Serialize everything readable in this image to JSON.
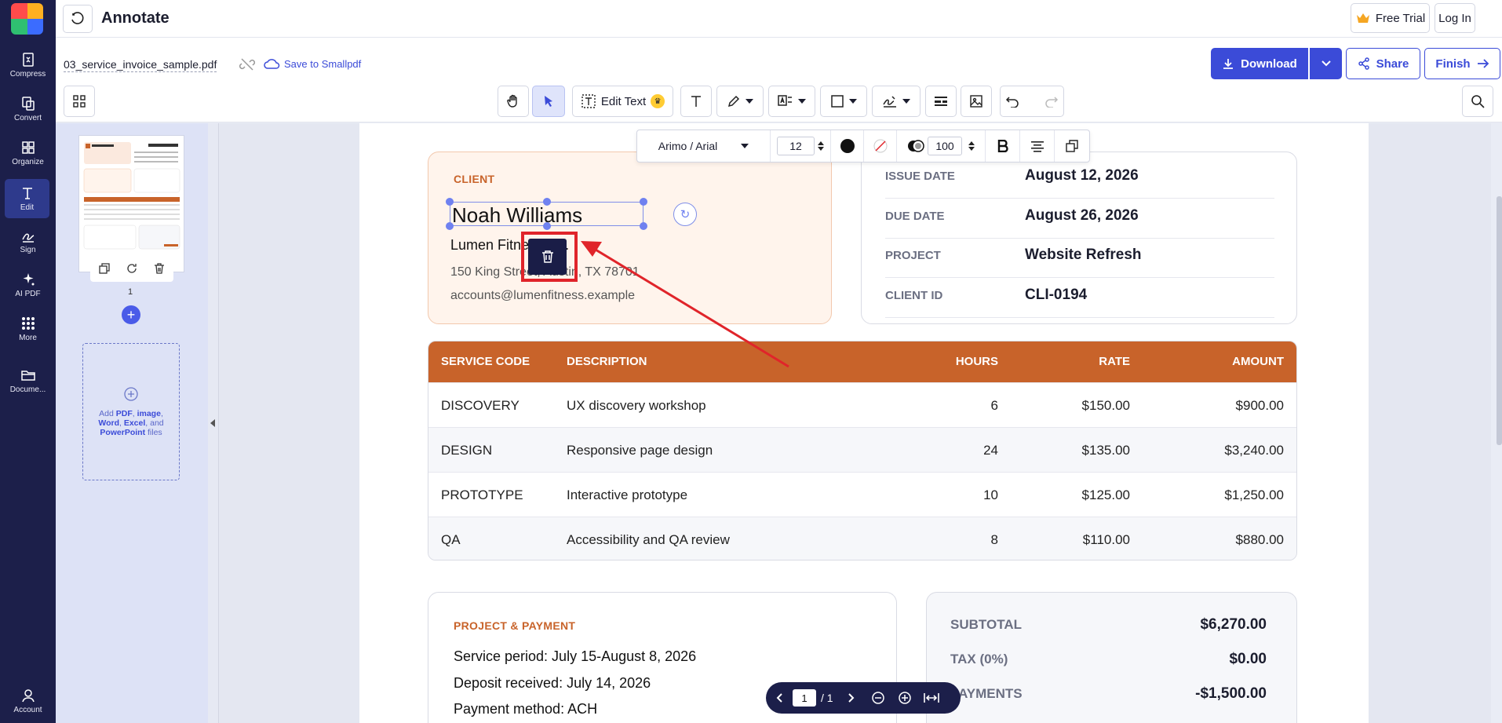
{
  "app": {
    "title": "Annotate"
  },
  "rail": {
    "items": [
      {
        "label": "Compress",
        "icon": "compress-icon"
      },
      {
        "label": "Convert",
        "icon": "convert-icon"
      },
      {
        "label": "Organize",
        "icon": "organize-icon"
      },
      {
        "label": "Edit",
        "icon": "edit-text-icon"
      },
      {
        "label": "Sign",
        "icon": "sign-icon"
      },
      {
        "label": "AI PDF",
        "icon": "ai-sparkle-icon"
      },
      {
        "label": "More",
        "icon": "more-grid-icon"
      },
      {
        "label": "Docume...",
        "icon": "folder-icon"
      }
    ],
    "account": "Account"
  },
  "header": {
    "free_trial": "Free Trial",
    "login": "Log In"
  },
  "file": {
    "name": "03_service_invoice_sample.pdf",
    "save_link": "Save to Smallpdf",
    "download": "Download",
    "share": "Share",
    "finish": "Finish"
  },
  "toolbar": {
    "edit_text": "Edit Text"
  },
  "format_bar": {
    "font": "Arimo / Arial",
    "size": "12",
    "opacity": "100"
  },
  "thumbs": {
    "page_number": "1",
    "dropzone": {
      "prefix": "Add ",
      "pdf": "PDF",
      "sep1": ", ",
      "image": "image",
      "sep2": ",",
      "word": "Word",
      "sep3": ", ",
      "excel": "Excel",
      "sep4": ", and ",
      "ppt": "PowerPoint",
      "suffix": " files"
    }
  },
  "invoice": {
    "client": {
      "label": "CLIENT",
      "name": "Noah Williams",
      "company": "Lumen Fitness Co.",
      "address": "150 King Street, Austin, TX 78701",
      "email": "accounts@lumenfitness.example"
    },
    "meta": [
      {
        "key": "ISSUE DATE",
        "value": "August 12, 2026"
      },
      {
        "key": "DUE DATE",
        "value": "August 26, 2026"
      },
      {
        "key": "PROJECT",
        "value": "Website Refresh"
      },
      {
        "key": "CLIENT ID",
        "value": "CLI-0194"
      }
    ],
    "table": {
      "headers": [
        "SERVICE CODE",
        "DESCRIPTION",
        "HOURS",
        "RATE",
        "AMOUNT"
      ],
      "rows": [
        [
          "DISCOVERY",
          "UX discovery workshop",
          "6",
          "$150.00",
          "$900.00"
        ],
        [
          "DESIGN",
          "Responsive page design",
          "24",
          "$135.00",
          "$3,240.00"
        ],
        [
          "PROTOTYPE",
          "Interactive prototype",
          "10",
          "$125.00",
          "$1,250.00"
        ],
        [
          "QA",
          "Accessibility and QA review",
          "8",
          "$110.00",
          "$880.00"
        ]
      ]
    },
    "payment": {
      "title": "PROJECT & PAYMENT",
      "lines": [
        "Service period: July 15-August 8, 2026",
        "Deposit received: July 14, 2026",
        "Payment method: ACH"
      ]
    },
    "totals": [
      {
        "key": "SUBTOTAL",
        "value": "$6,270.00"
      },
      {
        "key": "TAX (0%)",
        "value": "$0.00"
      },
      {
        "key": "PAYMENTS",
        "value": "-$1,500.00"
      }
    ]
  },
  "pager": {
    "current": "1",
    "total": "/ 1"
  },
  "colors": {
    "accent": "#3b4bd8",
    "rail": "#1c1f4a",
    "invoice_orange": "#c8632a",
    "annotation_red": "#e0242a"
  }
}
